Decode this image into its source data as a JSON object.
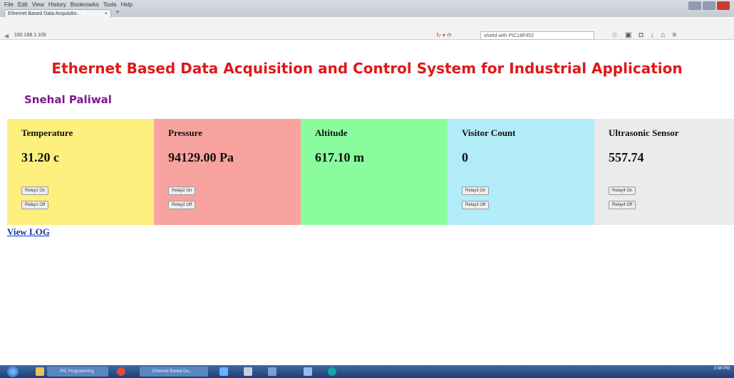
{
  "browser": {
    "menu": [
      "File",
      "Edit",
      "View",
      "History",
      "Bookmarks",
      "Tools",
      "Help"
    ],
    "tab_title": "Ethernet Based Data Acquisitio...",
    "tab_close": "×",
    "new_tab": "+",
    "url": "192.168.1.105",
    "search_placeholder": "shield with PIC18F452",
    "toolbar_icons": [
      "star-icon",
      "bookmark-icon",
      "pocket-icon",
      "download-icon",
      "home-icon",
      "menu-icon"
    ]
  },
  "page": {
    "title": "Ethernet Based Data Acquisition and Control System for Industrial Application",
    "author": "Snehal Paliwal",
    "view_log": "View LOG"
  },
  "panels": [
    {
      "label": "Temperature",
      "value": "31.20 c",
      "color": "#fdf07e",
      "on": "Relay1 On",
      "off": "Relay1 Off"
    },
    {
      "label": "Pressure",
      "value": "94129.00 Pa",
      "color": "#f9a3a0",
      "on": "Relay2 On",
      "off": "Relay2 Off"
    },
    {
      "label": "Altitude",
      "value": "617.10 m",
      "color": "#8afc9d"
    },
    {
      "label": "Visitor Count",
      "value": "0",
      "color": "#b1ecf8",
      "on": "Relay3 On",
      "off": "Relay3 Off"
    },
    {
      "label": "Ultrasonic Sensor",
      "value": "557.74",
      "color": "#ebebeb",
      "on": "Relay4 On",
      "off": "Relay4 Off"
    }
  ],
  "taskbar": {
    "items": [
      "PIC Programming",
      "Ethernet Based Da..."
    ],
    "time": "2:48 PM"
  }
}
